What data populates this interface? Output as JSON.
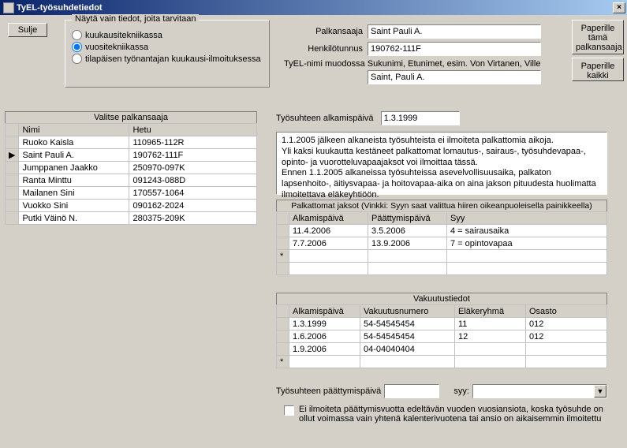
{
  "window": {
    "title": "TyEL-työsuhdetiedot"
  },
  "buttons": {
    "close": "Sulje",
    "print_one": "Paperille tämä palkansaaja",
    "print_all": "Paperille kaikki"
  },
  "filter": {
    "legend": "Näytä vain tiedot, joita tarvitaan",
    "opt_month": "kuukausitekniikassa",
    "opt_year": "vuositekniikassa",
    "opt_temp": "tilapäisen työnantajan kuukausi-ilmoituksessa"
  },
  "person": {
    "label_name": "Palkansaaja",
    "name": "Saint Pauli A.",
    "label_ssn": "Henkilötunnus",
    "ssn": "190762-111F",
    "label_tyel": "TyEL-nimi muodossa Sukunimi, Etunimet, esim. Von Virtanen, Ville",
    "tyel_name": "Saint, Pauli A."
  },
  "emp_list": {
    "title": "Valitse palkansaaja",
    "col_name": "Nimi",
    "col_ssn": "Hetu",
    "rows": [
      {
        "name": "Ruoko Kaisla",
        "ssn": "110965-112R",
        "sel": false
      },
      {
        "name": "Saint Pauli A.",
        "ssn": "190762-111F",
        "sel": true
      },
      {
        "name": "Jumppanen Jaakko",
        "ssn": "250970-097K",
        "sel": false
      },
      {
        "name": "Ranta Minttu",
        "ssn": "091243-088D",
        "sel": false
      },
      {
        "name": "Mailanen Sini",
        "ssn": "170557-1064",
        "sel": false
      },
      {
        "name": "Vuokko Sini",
        "ssn": "090162-2024",
        "sel": false
      },
      {
        "name": "Putki Väinö N.",
        "ssn": "280375-209K",
        "sel": false
      }
    ]
  },
  "start": {
    "label": "Työsuhteen alkamispäivä",
    "value": "1.3.1999"
  },
  "info": {
    "line1": "1.1.2005 jälkeen alkaneista työsuhteista ei ilmoiteta palkattomia aikoja.",
    "line2": "Yli kaksi kuukautta kestäneet palkattomat lomautus-, sairaus-, työsuhdevapaa-, opinto- ja vuorotteluvapaajaksot voi ilmoittaa tässä.",
    "line3": "Ennen 1.1.2005 alkaneissa työsuhteissa asevelvollisuusaika, palkaton lapsenhoito-, äitiysvapaa- ja hoitovapaa-aika on aina jakson pituudesta huolimatta ilmoitettava eläkeyhtiöön."
  },
  "unpaid": {
    "title": "Palkattomat jaksot (Vinkki: Syyn saat valittua hiiren oikeanpuoleisella painikkeella)",
    "col_start": "Alkamispäivä",
    "col_end": "Päättymispäivä",
    "col_reason": "Syy",
    "rows": [
      {
        "start": "11.4.2006",
        "end": "3.5.2006",
        "reason": "4 = sairausaika"
      },
      {
        "start": "7.7.2006",
        "end": "13.9.2006",
        "reason": "7 = opintovapaa"
      }
    ]
  },
  "insurance": {
    "title": "Vakuutustiedot",
    "col_start": "Alkamispäivä",
    "col_num": "Vakuutusnumero",
    "col_group": "Eläkeryhmä",
    "col_dept": "Osasto",
    "rows": [
      {
        "start": "1.3.1999",
        "num": "54-54545454",
        "group": "11",
        "dept": "012"
      },
      {
        "start": "1.6.2006",
        "num": "54-54545454",
        "group": "12",
        "dept": "012"
      },
      {
        "start": "1.9.2006",
        "num": "04-04040404",
        "group": "",
        "dept": ""
      }
    ]
  },
  "end": {
    "label_date": "Työsuhteen päättymispäivä",
    "date": "",
    "label_reason": "syy:",
    "reason": "",
    "checkbox": "Ei ilmoiteta päättymisvuotta edeltävän vuoden vuosiansiota, koska työsuhde on ollut voimassa vain yhtenä kalenterivuotena tai ansio on aikaisemmin ilmoitettu"
  }
}
